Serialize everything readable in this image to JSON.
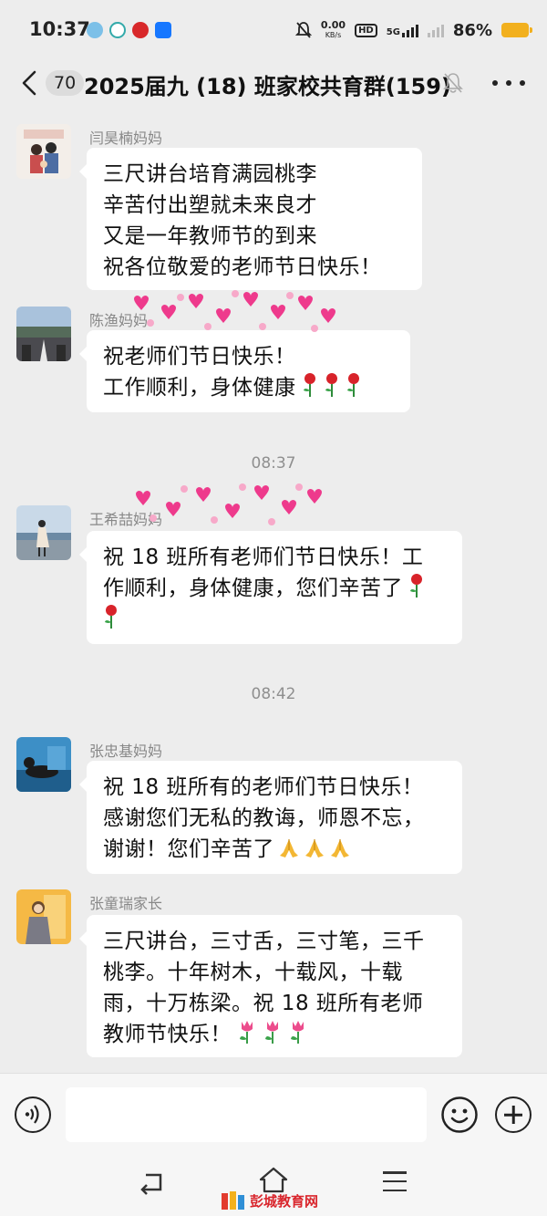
{
  "status_bar": {
    "time": "10:37",
    "net_speed_value": "0.00",
    "net_speed_unit": "KB/s",
    "hd_label": "HD",
    "net_type": "5G",
    "battery": "86%"
  },
  "header": {
    "unread_count": "70",
    "title": "2025届九 (18) 班家校共育群(159)"
  },
  "messages": [
    {
      "sender": "闫昊楠妈妈",
      "lines": [
        "三尺讲台培育满园桃李",
        "辛苦付出塑就未来良才",
        "又是一年教师节的到来",
        "祝各位敬爱的老师节日快乐！"
      ]
    },
    {
      "sender": "陈渔妈妈",
      "lines": [
        "祝老师们节日快乐！",
        "工作顺利，身体健康"
      ]
    },
    {
      "sender": "王希喆妈妈",
      "lines": [
        "祝 18 班所有老师们节日快乐！工",
        "作顺利，身体健康，您们辛苦了"
      ]
    },
    {
      "sender": "张忠基妈妈",
      "lines": [
        "祝 18 班所有的老师们节日快乐！",
        "感谢您们无私的教诲，师恩不忘，",
        "谢谢！您们辛苦了"
      ]
    },
    {
      "sender": "张童瑞家长",
      "lines": [
        "三尺讲台，三寸舌，三寸笔，三千",
        "桃李。十年树木，十载风，十载",
        "雨，十万栋梁。祝 18 班所有老师",
        "教师节快乐！"
      ]
    }
  ],
  "timestamps": [
    "08:37",
    "08:42"
  ],
  "input": {
    "placeholder": ""
  },
  "watermark": {
    "text": "彭城教育网"
  },
  "icons": {
    "rose": "rose-emoji",
    "tulip": "tulip-emoji",
    "pray": "folded-hands-emoji",
    "hearts": "heart-sticker-animation"
  },
  "colors": {
    "background": "#ededed",
    "bubble": "#ffffff",
    "battery": "#f2b01e",
    "watermark": "#d9252c"
  }
}
